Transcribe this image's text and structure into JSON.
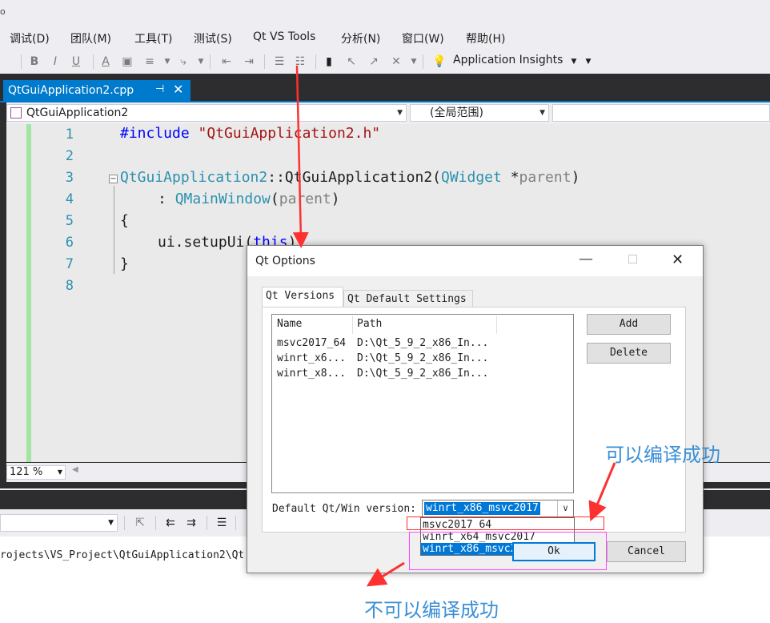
{
  "titlebar": {
    "fragment": "o"
  },
  "menu": {
    "items": [
      {
        "label": "调试(D)"
      },
      {
        "label": "团队(M)"
      },
      {
        "label": "工具(T)"
      },
      {
        "label": "测试(S)"
      },
      {
        "label": "Qt VS Tools"
      },
      {
        "label": "分析(N)"
      },
      {
        "label": "窗口(W)"
      },
      {
        "label": "帮助(H)"
      }
    ]
  },
  "toolbar": {
    "bold": "B",
    "italic": "I",
    "underline": "U",
    "font_color": "A",
    "application_insights": "Application Insights"
  },
  "editor": {
    "tab": {
      "label": "QtGuiApplication2.cpp",
      "pin": "⊣",
      "close": "✕"
    },
    "project_combo": "QtGuiApplication2",
    "scope_combo": "(全局范围)",
    "line_numbers": [
      "1",
      "2",
      "3",
      "4",
      "5",
      "6",
      "7",
      "8"
    ],
    "code": {
      "l1_kw": "#include",
      "l1_str": "\"QtGuiApplication2.h\"",
      "l3_class": "QtGuiApplication2",
      "l3_sep": "::",
      "l3_ctor": "QtGuiApplication2(",
      "l3_type": "QWidget",
      "l3_ptr": " *",
      "l3_param": "parent",
      "l3_close": ")",
      "l4_colon": ": ",
      "l4_type": "QMainWindow",
      "l4_open": "(",
      "l4_param": "parent",
      "l4_close": ")",
      "l5": "{",
      "l6_call": "ui.setupUi(",
      "l6_kw": "this",
      "l6_end": ");",
      "l7": "}"
    },
    "zoom": "121 %"
  },
  "output": {
    "path": "rojects\\VS_Project\\QtGuiApplication2\\Qt"
  },
  "dialog": {
    "title": "Qt Options",
    "tabs": {
      "versions": "Qt Versions",
      "defaults": "Qt Default Settings"
    },
    "columns": {
      "name": "Name",
      "path": "Path"
    },
    "rows": [
      {
        "name": "msvc2017_64",
        "path": "D:\\Qt_5_9_2_x86_In..."
      },
      {
        "name": "winrt_x6...",
        "path": "D:\\Qt_5_9_2_x86_In..."
      },
      {
        "name": "winrt_x8...",
        "path": "D:\\Qt_5_9_2_x86_In..."
      }
    ],
    "add_button": "Add",
    "delete_button": "Delete",
    "default_label": "Default Qt/Win version:",
    "default_value": "winrt_x86_msvc2017",
    "options": [
      "msvc2017_64",
      "winrt_x64_msvc2017",
      "winrt_x86_msvc2017"
    ],
    "ok_button": "Ok",
    "cancel_button": "Cancel"
  },
  "annotations": {
    "can_compile": "可以编译成功",
    "cannot_compile": "不可以编译成功",
    "red": "#ff3030",
    "magenta": "#ff40ff",
    "text_color": "#3a8fd6"
  }
}
